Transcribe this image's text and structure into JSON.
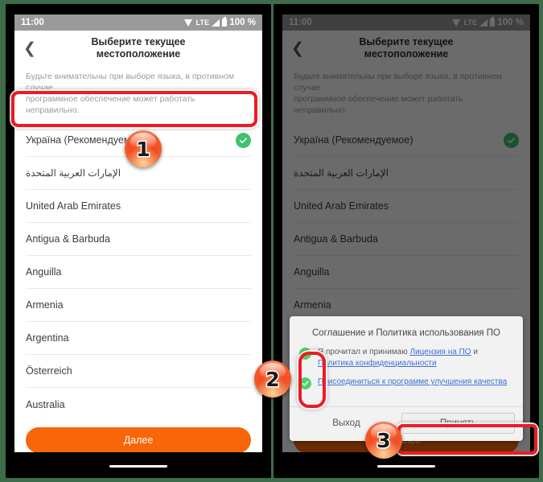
{
  "background_color": "#3e6b4a",
  "accent_orange": "#f86609",
  "accent_red": "#ec1c24",
  "check_green": "#3ec46d",
  "link_blue": "#3d6fd6",
  "status_bar": {
    "time": "11:00",
    "network_label": "LTE",
    "battery_percent": "100 %",
    "icons": [
      "wifi-icon",
      "signal-icon",
      "battery-icon"
    ]
  },
  "nav": {
    "back_icon": "chevron-left-icon",
    "title_line1": "Выберите текущее",
    "title_line2": "местоположение"
  },
  "hint": {
    "line1": "Будьте внимательны при выборе языка, в противном случае",
    "line2": "программное обеспечение может работать неправильно."
  },
  "country_list": [
    {
      "label": "Україна (Рекомендуемое)",
      "selected": true,
      "rtl": false
    },
    {
      "label": "الإمارات العربية المتحدة",
      "selected": false,
      "rtl": true
    },
    {
      "label": "United Arab Emirates",
      "selected": false,
      "rtl": false
    },
    {
      "label": "Antigua & Barbuda",
      "selected": false,
      "rtl": false
    },
    {
      "label": "Anguilla",
      "selected": false,
      "rtl": false
    },
    {
      "label": "Armenia",
      "selected": false,
      "rtl": false
    },
    {
      "label": "Argentina",
      "selected": false,
      "rtl": false
    },
    {
      "label": "Österreich",
      "selected": false,
      "rtl": false
    },
    {
      "label": "Australia",
      "selected": false,
      "rtl": false
    }
  ],
  "primary_button": {
    "label": "Далее"
  },
  "dialog": {
    "title": "Соглашение и Политика использования ПО",
    "checkbox1": {
      "text_before": "Я прочитал и принимаю ",
      "link1": "Лицензия на ПО",
      "text_mid": " и ",
      "link2": "Политика конфиденциальности",
      "checked": true
    },
    "checkbox2": {
      "link1": "Присоединиться к программе улучшения качества",
      "checked": true
    },
    "exit_button": "Выход",
    "accept_button": "Принять"
  },
  "annotations": {
    "badge1": "1",
    "badge2": "2",
    "badge3": "3"
  }
}
